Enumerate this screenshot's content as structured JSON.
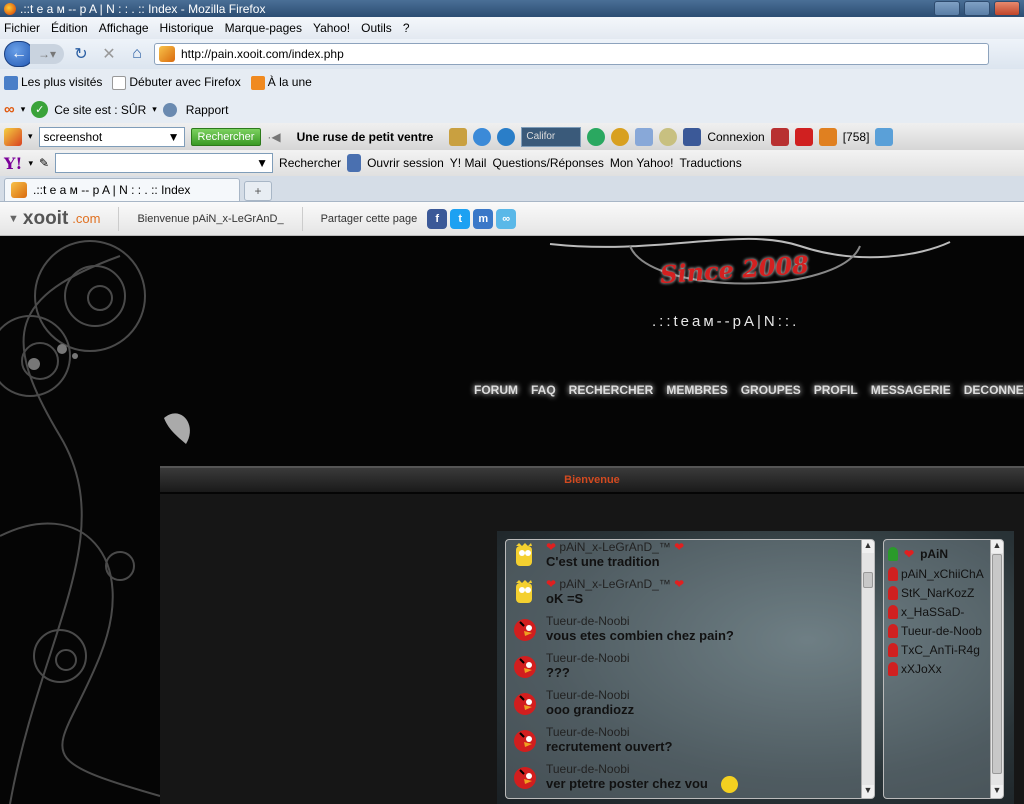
{
  "window": {
    "title": ".::t e a м -- p A | N : : . :: Index - Mozilla Firefox"
  },
  "menu": [
    "Fichier",
    "Édition",
    "Affichage",
    "Historique",
    "Marque-pages",
    "Yahoo!",
    "Outils",
    "?"
  ],
  "nav": {
    "url": "http://pain.xooit.com/index.php"
  },
  "bookmarks": [
    "Les plus visités",
    "Débuter avec Firefox",
    "À la une"
  ],
  "wot": {
    "status": "Ce site est : SÛR",
    "report": "Rapport"
  },
  "searchbar": {
    "query": "screenshot",
    "search_btn": "Rechercher",
    "headline": "Une ruse de petit ventre",
    "weather": "Califor",
    "connexion": "Connexion",
    "count": "[758]"
  },
  "yahoo": {
    "search": "Rechercher",
    "login": "Ouvrir session",
    "mail": "Y! Mail",
    "qa": "Questions/Réponses",
    "myyahoo": "Mon Yahoo!",
    "trad": "Traductions"
  },
  "tab": {
    "label": ".::t e a м -- p A | N : : . :: Index"
  },
  "xooit": {
    "logo": "xooit",
    "logo_com": ".com",
    "welcome": "Bienvenue pAiN_x-LeGrAnD_",
    "share": "Partager cette page"
  },
  "forum": {
    "since": "Since 2008",
    "team": ".::tеaм--pA|N::.",
    "nav": [
      "FORUM",
      "FAQ",
      "RECHERCHER",
      "MEMBRES",
      "GROUPES",
      "PROFIL",
      "MESSAGERIE",
      "DECONNEXION"
    ],
    "welcome_bar": "Bienvenue"
  },
  "chat": {
    "messages": [
      {
        "author": "pAiN_x-LeGrAnD_™",
        "text": "C'est une tradition",
        "avatar": "bart"
      },
      {
        "author": "pAiN_x-LeGrAnD_™",
        "text": "oK =S",
        "avatar": "bart"
      },
      {
        "author": "Tueur-de-Noobi",
        "text": "vous etes combien chez pain?",
        "avatar": "angry-bird"
      },
      {
        "author": "Tueur-de-Noobi",
        "text": "???",
        "avatar": "angry-bird"
      },
      {
        "author": "Tueur-de-Noobi",
        "text": "ooo grandiozz",
        "avatar": "angry-bird"
      },
      {
        "author": "Tueur-de-Noobi",
        "text": "recrutement ouvert?",
        "avatar": "angry-bird"
      },
      {
        "author": "Tueur-de-Noobi",
        "text": "ver ptetre poster chez vou",
        "avatar": "angry-bird"
      }
    ],
    "users": [
      {
        "name": "pAiN",
        "online": true
      },
      {
        "name": "pAiN_xChiiChA",
        "online": false
      },
      {
        "name": "StK_NarKozZ",
        "online": false
      },
      {
        "name": "x_HaSSaD-",
        "online": false
      },
      {
        "name": "Tueur-de-Noob",
        "online": false
      },
      {
        "name": "TxC_AnTi-R4g",
        "online": false
      },
      {
        "name": "xXJoXx",
        "online": false
      }
    ]
  }
}
